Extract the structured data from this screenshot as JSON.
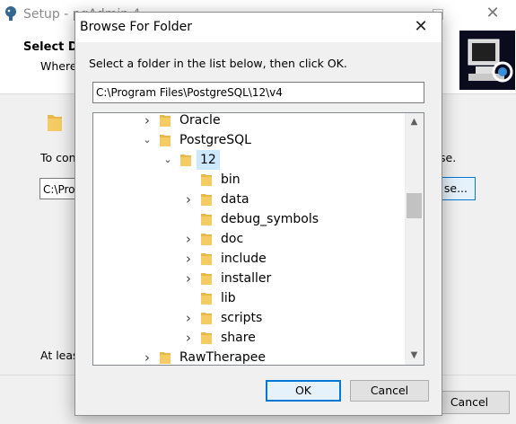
{
  "background_window": {
    "title": "Setup - pgAdmin 4",
    "close_glyph": "✕",
    "header_title": "Select De",
    "header_subtitle": "Where",
    "body_text_left": "To con",
    "body_text_right": "se.",
    "path_value": "C:\\Prog",
    "browse_label": "se...",
    "disk_space_text": "At leas",
    "cancel_label": "Cancel"
  },
  "dialog": {
    "title": "Browse For Folder",
    "close_glyph": "✕",
    "instruction": "Select a folder in the list below, then click OK.",
    "path_value": "C:\\Program Files\\PostgreSQL\\12\\v4",
    "tree": [
      {
        "label": "Oracle",
        "expander": "›",
        "selected": false
      },
      {
        "label": "PostgreSQL",
        "expander": "⌄",
        "selected": false
      },
      {
        "label": "12",
        "expander": "⌄",
        "selected": true
      },
      {
        "label": "bin",
        "expander": "",
        "selected": false
      },
      {
        "label": "data",
        "expander": "›",
        "selected": false
      },
      {
        "label": "debug_symbols",
        "expander": "",
        "selected": false
      },
      {
        "label": "doc",
        "expander": "›",
        "selected": false
      },
      {
        "label": "include",
        "expander": "›",
        "selected": false
      },
      {
        "label": "installer",
        "expander": "›",
        "selected": false
      },
      {
        "label": "lib",
        "expander": "",
        "selected": false
      },
      {
        "label": "scripts",
        "expander": "›",
        "selected": false
      },
      {
        "label": "share",
        "expander": "›",
        "selected": false
      },
      {
        "label": "RawTherapee",
        "expander": "›",
        "selected": false
      }
    ],
    "scroll_up_glyph": "▲",
    "scroll_down_glyph": "▼",
    "ok_label": "OK",
    "cancel_label": "Cancel"
  },
  "colors": {
    "selection": "#cce8ff",
    "accent": "#0078d7",
    "folder": "#e8b84a"
  },
  "icons": [
    "app-icon",
    "close-icon",
    "folder-icon",
    "chevron-right-icon",
    "chevron-down-icon",
    "scroll-up-icon",
    "scroll-down-icon"
  ]
}
